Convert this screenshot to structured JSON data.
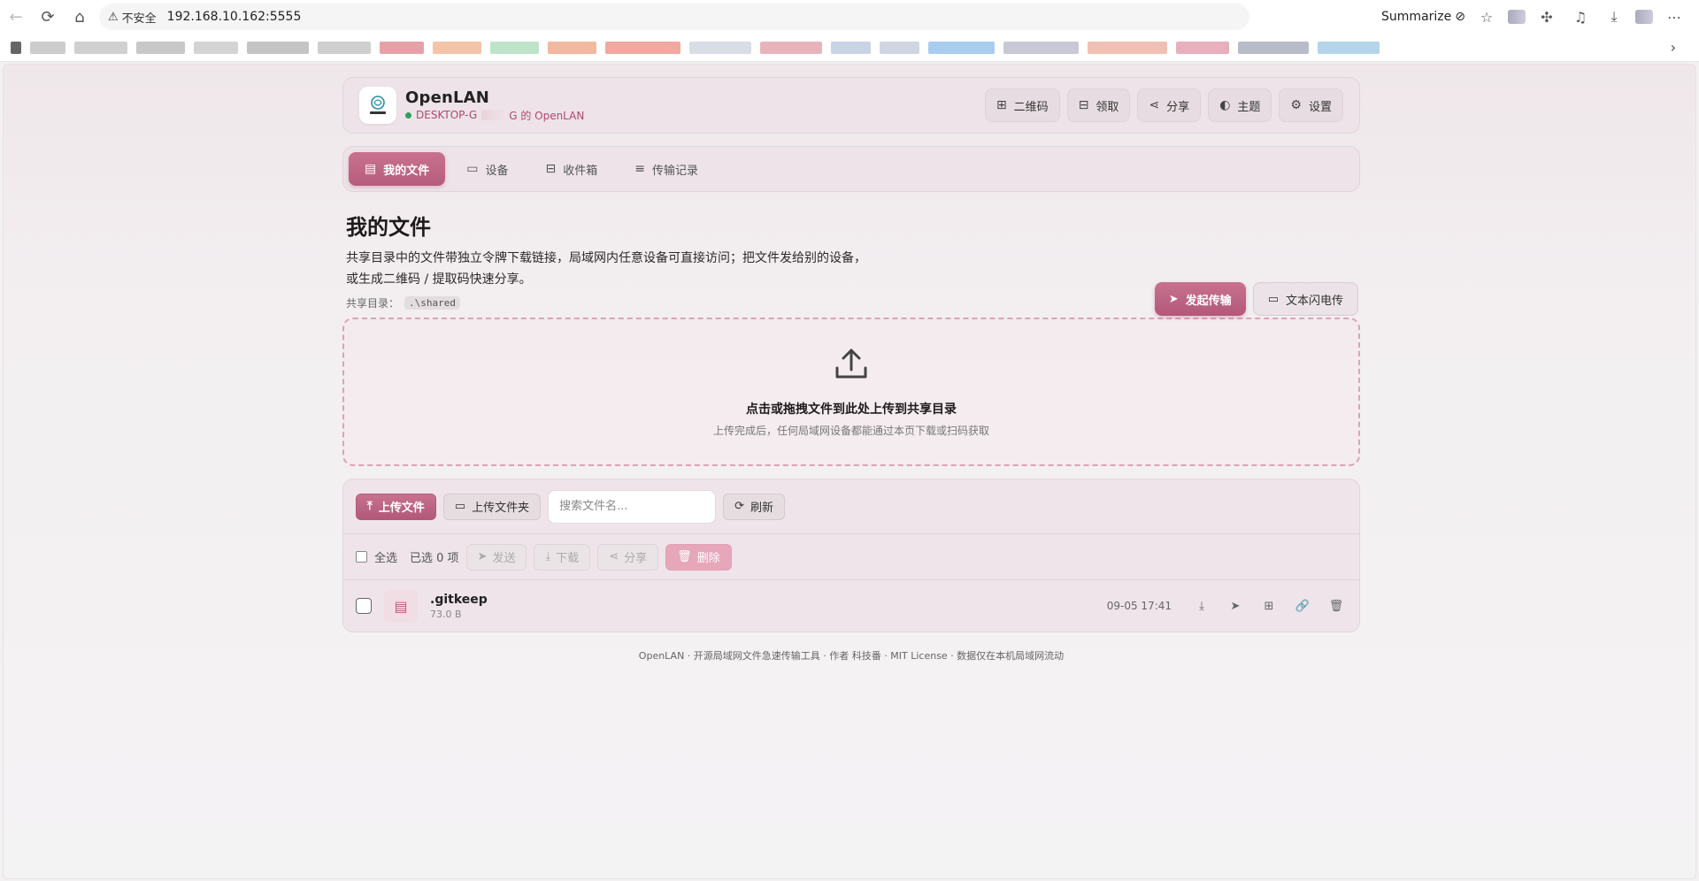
{
  "browser": {
    "insecure_label": "不安全",
    "url": "192.168.10.162:5555",
    "summarize_label": "Summarize"
  },
  "app": {
    "name": "OpenLAN",
    "host_prefix": "DESKTOP-G",
    "host_suffix": "G 的 OpenLAN",
    "logo_text": "OpenLAN",
    "accent": "#b75c7c",
    "status_color": "#2fa062"
  },
  "header_actions": [
    {
      "label": "二维码",
      "icon": "qr-icon"
    },
    {
      "label": "领取",
      "icon": "inbox-icon"
    },
    {
      "label": "分享",
      "icon": "share-icon"
    },
    {
      "label": "主题",
      "icon": "palette-icon"
    },
    {
      "label": "设置",
      "icon": "gear-icon"
    }
  ],
  "tabs": [
    {
      "label": "我的文件",
      "icon": "file-icon",
      "active": true
    },
    {
      "label": "设备",
      "icon": "devices-icon"
    },
    {
      "label": "收件箱",
      "icon": "inbox-icon"
    },
    {
      "label": "传输记录",
      "icon": "list-icon"
    }
  ],
  "section": {
    "title": "我的文件",
    "desc_line1": "共享目录中的文件带独立令牌下载链接，局域网内任意设备可直接访问；把文件发给别的设备，",
    "desc_line2": "或生成二维码 / 提取码快速分享。",
    "share_dir_label": "共享目录：",
    "share_dir_value": ".\\shared",
    "start_transfer": "发起传输",
    "text_flash": "文本闪电传"
  },
  "dropzone": {
    "title": "点击或拖拽文件到此处上传到共享目录",
    "subtitle": "上传完成后，任何局域网设备都能通过本页下载或扫码获取"
  },
  "toolbar": {
    "upload_file": "上传文件",
    "upload_folder": "上传文件夹",
    "search_placeholder": "搜索文件名...",
    "refresh": "刷新"
  },
  "selectbar": {
    "select_all": "全选",
    "selected_count": "已选 0 项",
    "send": "发送",
    "download": "下载",
    "share": "分享",
    "delete": "删除"
  },
  "files": [
    {
      "name": ".gitkeep",
      "size": "73.0 B",
      "time": "09-05 17:41"
    }
  ],
  "footer": "OpenLAN · 开源局域网文件急速传输工具 · 作者 科技番 · MIT License · 数据仅在本机局域网流动"
}
